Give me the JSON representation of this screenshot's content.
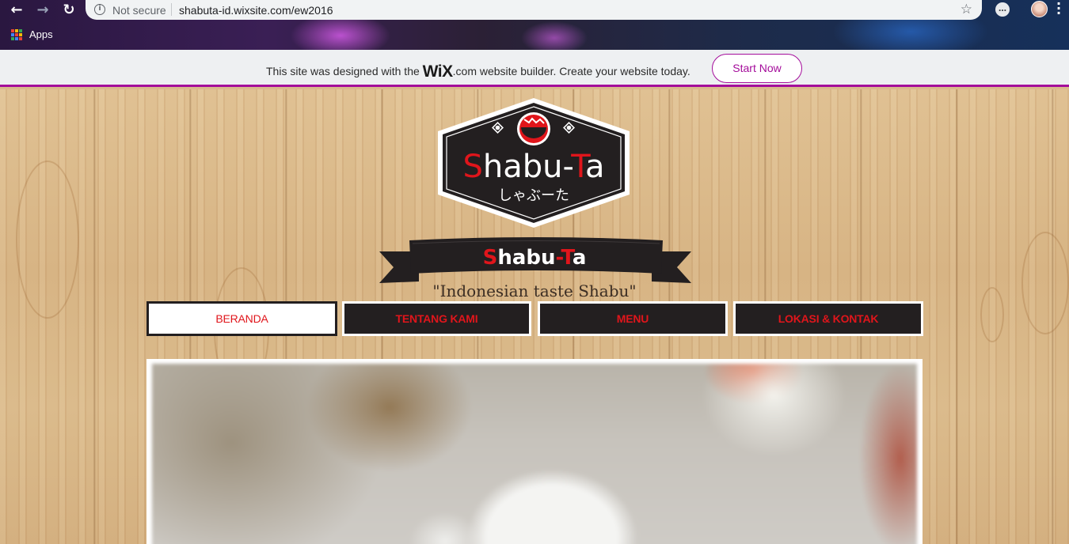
{
  "browser": {
    "back_icon": "←",
    "forward_icon": "→",
    "reload_icon": "↻",
    "security_label": "Not secure",
    "url": "shabuta-id.wixsite.com/ew2016",
    "bookmark_icon": "☆",
    "bookmarks": {
      "apps_label": "Apps"
    }
  },
  "wix_banner": {
    "text_before": "This site was designed with the",
    "logo_text": "WiX",
    "text_after": ".com website builder. Create your website today.",
    "button_label": "Start Now",
    "accent_color": "#a40d9b"
  },
  "site": {
    "logo_title_s": "S",
    "logo_title_rest": "habu-",
    "logo_title_t": "T",
    "logo_title_end": "a",
    "logo_kana": "しゃぶーた",
    "ribbon_s": "S",
    "ribbon_mid": "habu",
    "ribbon_dash": "-",
    "ribbon_t": "T",
    "ribbon_end": "a",
    "tagline": "\"Indonesian taste Shabu\"",
    "brand_red": "#e0151b",
    "brand_dark": "#231f20"
  },
  "nav": {
    "items": [
      {
        "label": "BERANDA",
        "active": true
      },
      {
        "label": "TENTANG KAMI",
        "active": false
      },
      {
        "label": "MENU",
        "active": false
      },
      {
        "label": "LOKASI & KONTAK",
        "active": false
      }
    ]
  }
}
